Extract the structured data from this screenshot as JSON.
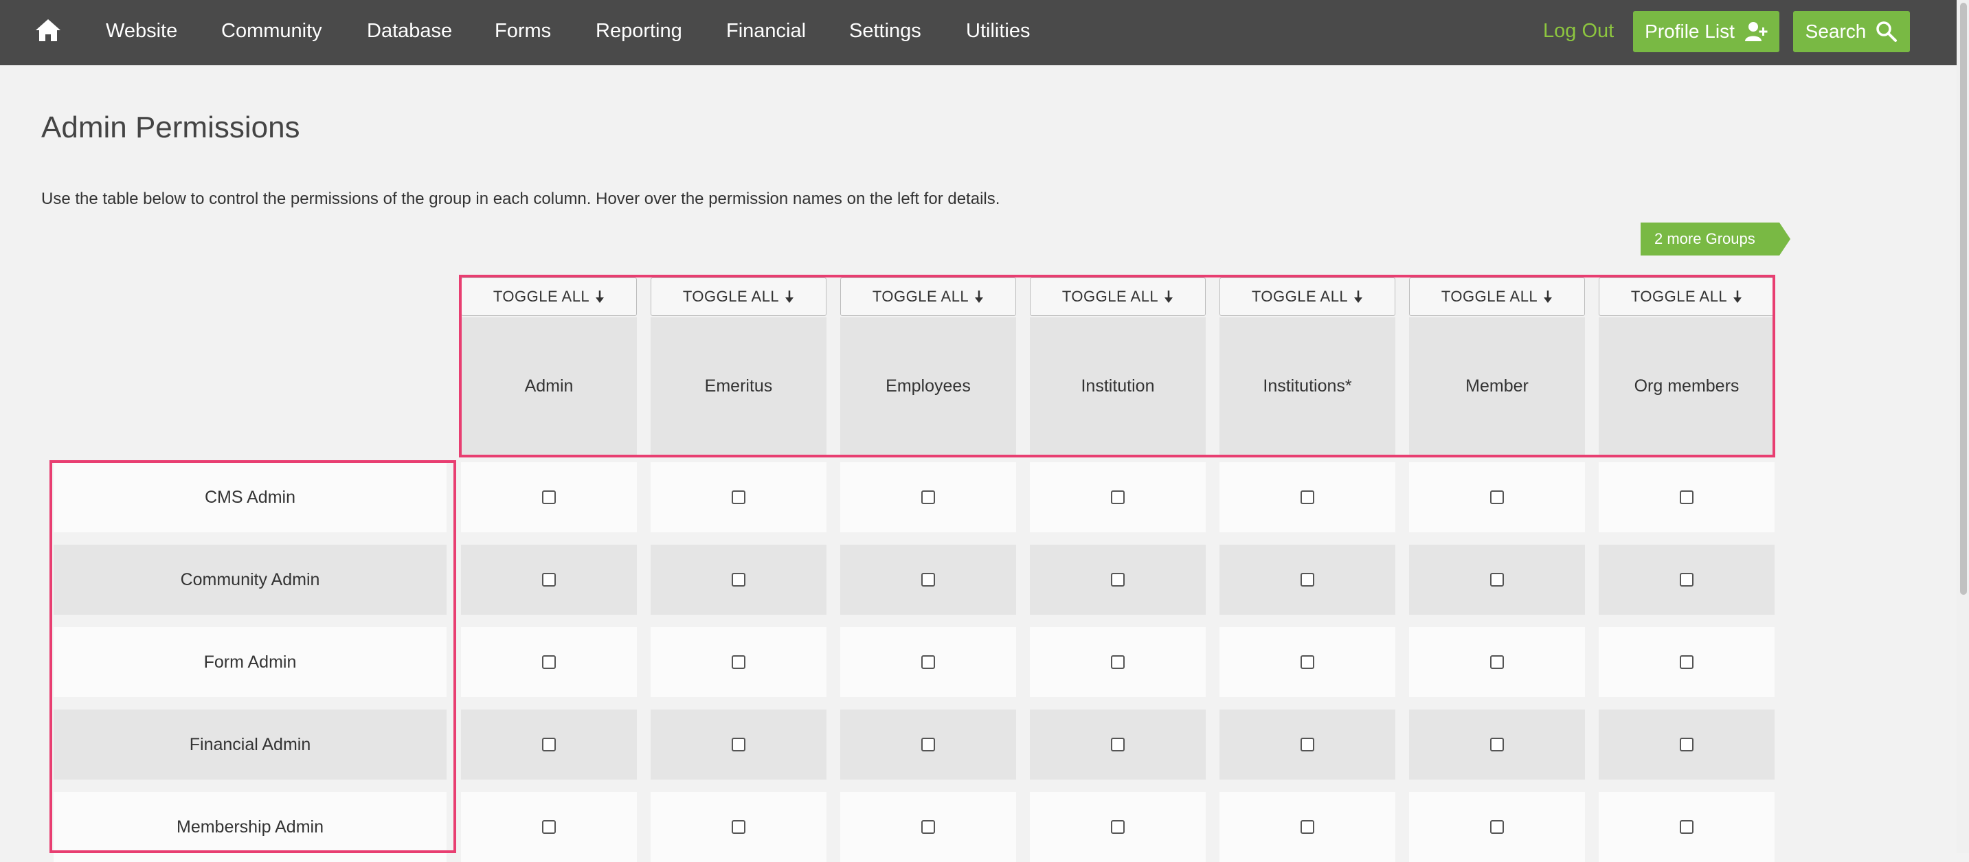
{
  "nav": {
    "items": [
      "Website",
      "Community",
      "Database",
      "Forms",
      "Reporting",
      "Financial",
      "Settings",
      "Utilities"
    ],
    "logout": "Log Out",
    "profile_list": "Profile List",
    "search": "Search"
  },
  "page": {
    "title": "Admin Permissions",
    "description": "Use the table below to control the permissions of the group in each column. Hover over the permission names on the left for details.",
    "more_groups": "2 more Groups"
  },
  "table": {
    "toggle_label": "TOGGLE ALL",
    "groups": [
      "Admin",
      "Emeritus",
      "Employees",
      "Institution",
      "Institutions*",
      "Member",
      "Org members"
    ],
    "permissions": [
      "CMS Admin",
      "Community Admin",
      "Form Admin",
      "Financial Admin",
      "Membership Admin"
    ]
  },
  "colors": {
    "nav_bg": "#4a4a4a",
    "accent_green": "#79b944",
    "logout_green": "#8dc63f",
    "highlight": "#e83e71"
  },
  "icons": [
    "home-icon",
    "add-user-icon",
    "search-icon",
    "arrow-down-icon"
  ]
}
